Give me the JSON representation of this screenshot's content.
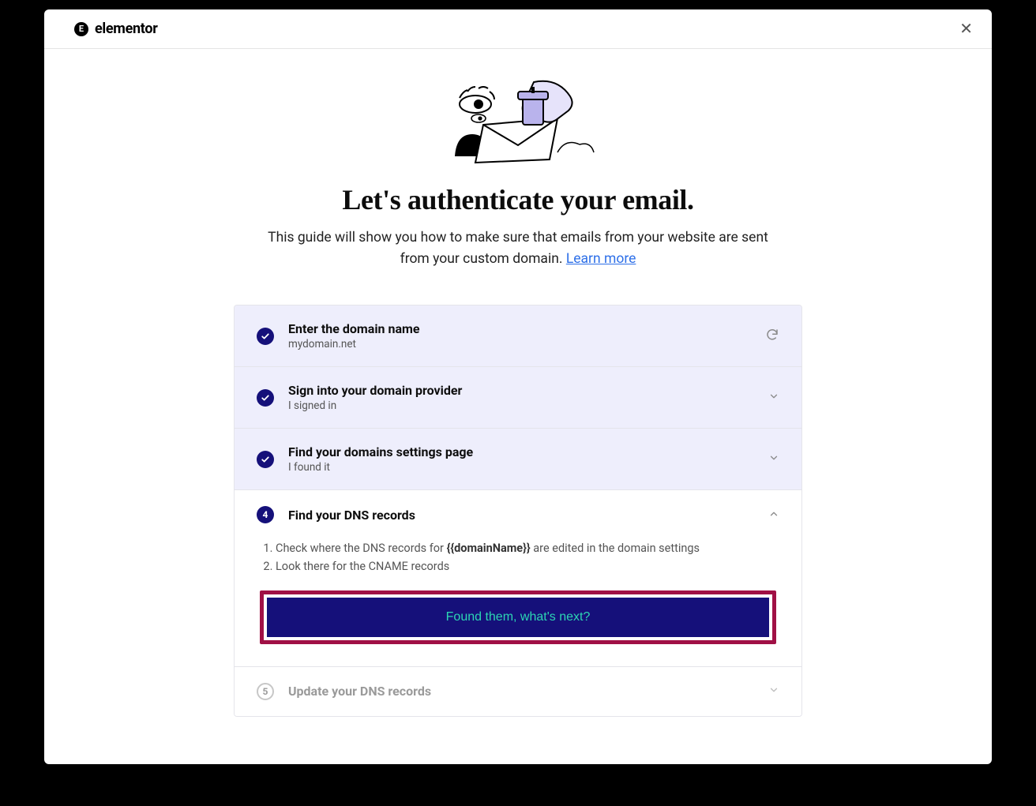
{
  "brand": {
    "name": "elementor",
    "logo_letter": "E"
  },
  "header": {
    "title": "Let's authenticate your email.",
    "subtitle_pre": "This guide will show you how to make sure that emails from your website are sent from your custom domain. ",
    "learn_more": "Learn more"
  },
  "steps": [
    {
      "state": "completed",
      "title": "Enter the domain name",
      "subtitle": "mydomain.net",
      "action_icon": "refresh"
    },
    {
      "state": "completed",
      "title": "Sign into your domain provider",
      "subtitle": "I signed in",
      "action_icon": "chevron-down"
    },
    {
      "state": "completed",
      "title": "Find your domains settings page",
      "subtitle": "I found it",
      "action_icon": "chevron-down"
    },
    {
      "state": "active",
      "number": "4",
      "title": "Find your DNS records",
      "action_icon": "chevron-up",
      "body": {
        "li1_pre": "Check where the DNS records for ",
        "li1_bold": "{{domainName}}",
        "li1_post": " are edited in the domain settings",
        "li2": "Look there for the CNAME records"
      },
      "cta": "Found them, what's next?"
    },
    {
      "state": "pending",
      "number": "5",
      "title": "Update your DNS records",
      "action_icon": "chevron-down"
    }
  ]
}
